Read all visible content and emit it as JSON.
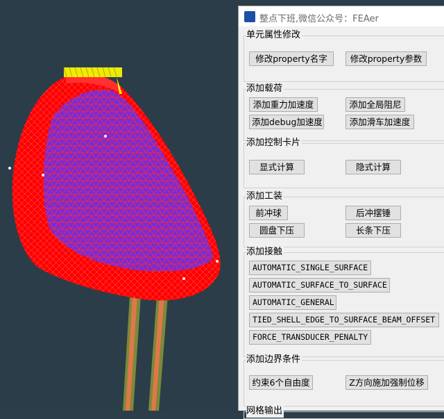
{
  "window": {
    "title": "整点下班,微信公众号：FEAer"
  },
  "groups": {
    "property": {
      "title": "单元属性修改",
      "buttons": [
        "修改property名字",
        "修改property参数"
      ]
    },
    "load": {
      "title": "添加载荷",
      "buttons": [
        "添加重力加速度",
        "添加全局阻尼",
        "添加debug加速度",
        "添加滑车加速度"
      ]
    },
    "control": {
      "title": "添加控制卡片",
      "buttons": [
        "显式计算",
        "隐式计算"
      ]
    },
    "tooling": {
      "title": "添加工装",
      "buttons": [
        "前冲球",
        "后冲摆锤",
        "圆盘下压",
        "长条下压"
      ]
    },
    "contact": {
      "title": "添加接触",
      "buttons": [
        "AUTOMATIC_SINGLE_SURFACE",
        "AUTOMATIC_SURFACE_TO_SURFACE",
        "AUTOMATIC_GENERAL",
        "TIED_SHELL_EDGE_TO_SURFACE_BEAM_OFFSET",
        "FORCE_TRANSDUCER_PENALTY"
      ]
    },
    "boundary": {
      "title": "添加边界条件",
      "buttons": [
        "约束6个自由度",
        "Z方向施加强制位移"
      ]
    },
    "output": {
      "title": "网格输出"
    }
  },
  "colors": {
    "mesh_outer": "#ff0000",
    "mesh_inner": "#7a2bd6",
    "viewport_bg": "#2b3d49",
    "load_arrows": "#ffff00"
  }
}
